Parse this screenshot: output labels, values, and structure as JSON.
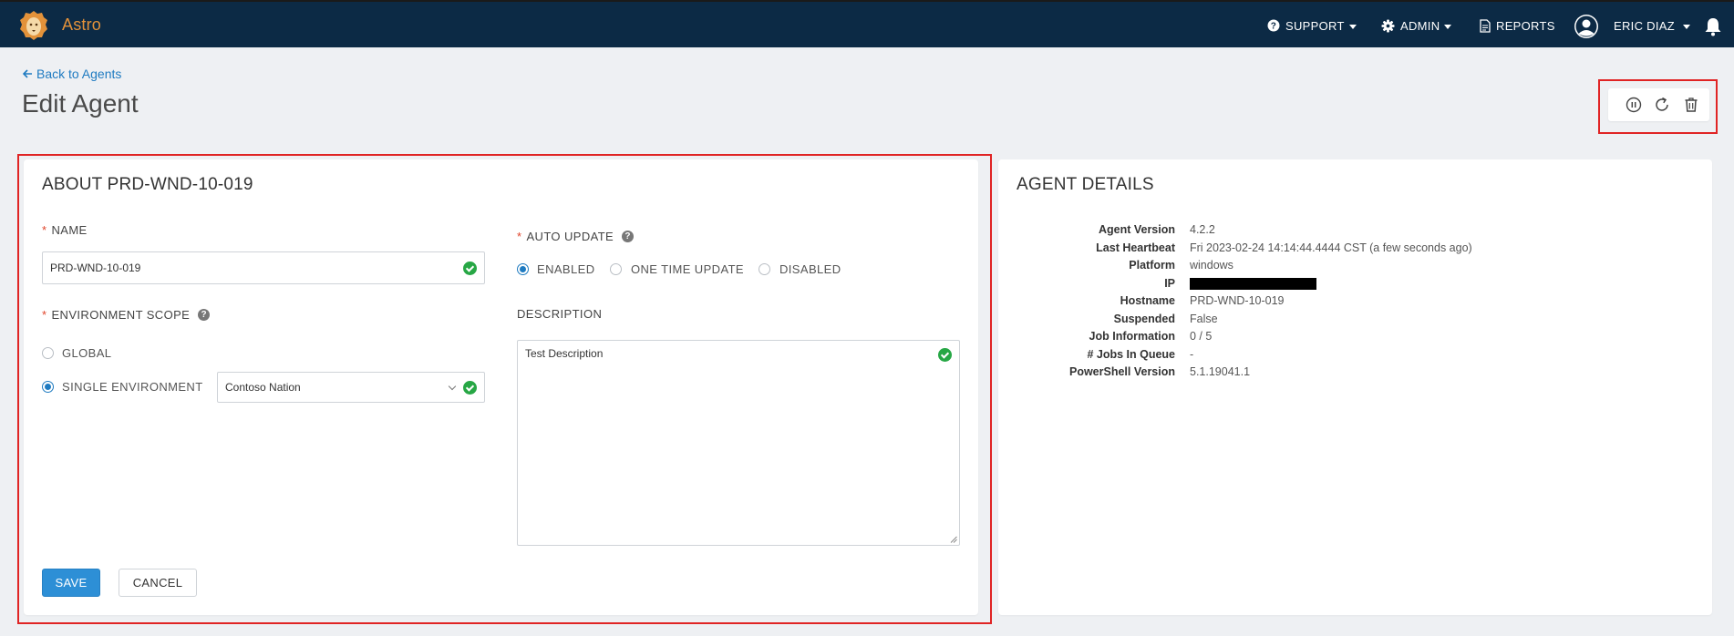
{
  "app": {
    "name": "Astro"
  },
  "nav": {
    "support": "SUPPORT",
    "admin": "ADMIN",
    "reports": "REPORTS",
    "user": "ERIC DIAZ"
  },
  "header": {
    "back_link": "Back to Agents",
    "title": "Edit Agent",
    "actions": [
      "pause-icon",
      "refresh-icon",
      "trash-icon"
    ]
  },
  "about": {
    "title": "ABOUT PRD-WND-10-019",
    "name_label": "NAME",
    "name_value": "PRD-WND-10-019",
    "env_scope_label": "ENVIRONMENT SCOPE",
    "env_global": "GLOBAL",
    "env_single": "SINGLE ENVIRONMENT",
    "env_selected": "Contoso Nation",
    "auto_update_label": "AUTO UPDATE",
    "auto_update_options": [
      "ENABLED",
      "ONE TIME UPDATE",
      "DISABLED"
    ],
    "auto_update_selected": "ENABLED",
    "description_label": "DESCRIPTION",
    "description_value": "Test Description",
    "save": "SAVE",
    "cancel": "CANCEL"
  },
  "details": {
    "title": "AGENT DETAILS",
    "rows": [
      {
        "key": "Agent Version",
        "value": "4.2.2"
      },
      {
        "key": "Last Heartbeat",
        "value": "Fri 2023-02-24 14:14:44.4444 CST (a few seconds ago)"
      },
      {
        "key": "Platform",
        "value": "windows"
      },
      {
        "key": "IP",
        "value": ""
      },
      {
        "key": "Hostname",
        "value": "PRD-WND-10-019"
      },
      {
        "key": "Suspended",
        "value": "False"
      },
      {
        "key": "Job Information",
        "value": "0 / 5"
      },
      {
        "key": "# Jobs In Queue",
        "value": "-"
      },
      {
        "key": "PowerShell Version",
        "value": "5.1.19041.1"
      }
    ]
  },
  "colors": {
    "nav_bg": "#0c2a45",
    "brand": "#e3923a",
    "accent": "#2d8fd6",
    "success": "#27a745",
    "required": "#e0452b",
    "highlight_outline": "#e02424"
  }
}
